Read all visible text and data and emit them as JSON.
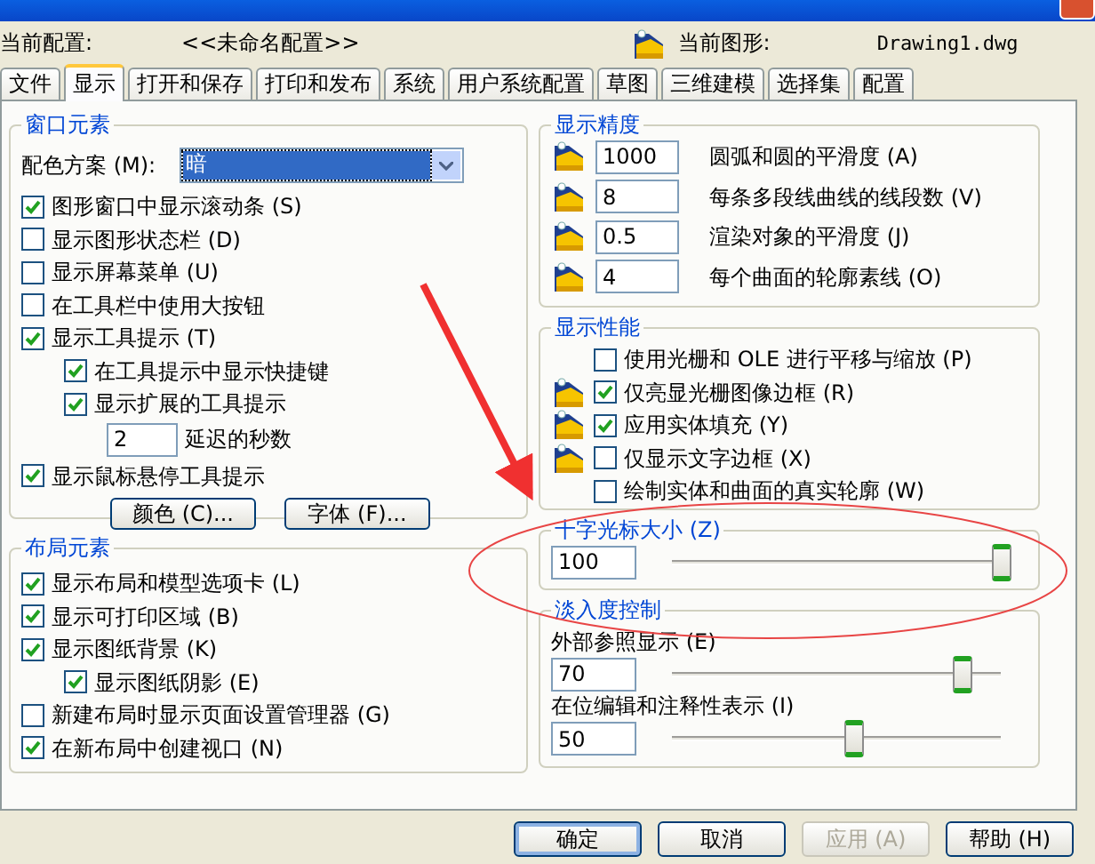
{
  "header": {
    "profile_label": "当前配置:",
    "profile_value": "<<未命名配置>>",
    "drawing_label": "当前图形:",
    "drawing_value": "Drawing1.dwg"
  },
  "tabs": [
    {
      "label": "文件",
      "selected": false
    },
    {
      "label": "显示",
      "selected": true
    },
    {
      "label": "打开和保存",
      "selected": false
    },
    {
      "label": "打印和发布",
      "selected": false
    },
    {
      "label": "系统",
      "selected": false
    },
    {
      "label": "用户系统配置",
      "selected": false
    },
    {
      "label": "草图",
      "selected": false
    },
    {
      "label": "三维建模",
      "selected": false
    },
    {
      "label": "选择集",
      "selected": false
    },
    {
      "label": "配置",
      "selected": false
    }
  ],
  "window_elements": {
    "title": "窗口元素",
    "color_scheme": {
      "label": "配色方案 (M):",
      "value": "暗"
    },
    "items": [
      {
        "kind": "checkbox",
        "label": "图形窗口中显示滚动条 (S)",
        "checked": true
      },
      {
        "kind": "checkbox",
        "label": "显示图形状态栏 (D)",
        "checked": false
      },
      {
        "kind": "checkbox",
        "label": "显示屏幕菜单 (U)",
        "checked": false
      },
      {
        "kind": "checkbox",
        "label": "在工具栏中使用大按钮",
        "checked": false
      },
      {
        "kind": "checkbox",
        "label": "显示工具提示 (T)",
        "checked": true,
        "children": [
          {
            "kind": "checkbox",
            "label": "在工具提示中显示快捷键",
            "checked": true
          },
          {
            "kind": "checkbox",
            "label": "显示扩展的工具提示",
            "checked": true,
            "children": [
              {
                "kind": "number",
                "value": "2",
                "label": "延迟的秒数"
              }
            ]
          }
        ]
      },
      {
        "kind": "checkbox",
        "label": "显示鼠标悬停工具提示",
        "checked": true
      }
    ],
    "buttons": [
      "颜色 (C)...",
      "字体 (F)..."
    ]
  },
  "layout_elements": {
    "title": "布局元素",
    "items": [
      {
        "kind": "checkbox",
        "label": "显示布局和模型选项卡 (L)",
        "checked": true
      },
      {
        "kind": "checkbox",
        "label": "显示可打印区域 (B)",
        "checked": true
      },
      {
        "kind": "checkbox",
        "label": "显示图纸背景 (K)",
        "checked": true,
        "children": [
          {
            "kind": "checkbox",
            "label": "显示图纸阴影 (E)",
            "checked": true
          }
        ]
      },
      {
        "kind": "checkbox",
        "label": "新建布局时显示页面设置管理器 (G)",
        "checked": false
      },
      {
        "kind": "checkbox",
        "label": "在新布局中创建视口 (N)",
        "checked": true
      }
    ]
  },
  "display_resolution": {
    "title": "显示精度",
    "rows": [
      {
        "value": "1000",
        "label": "圆弧和圆的平滑度 (A)"
      },
      {
        "value": "8",
        "label": "每条多段线曲线的线段数 (V)"
      },
      {
        "value": "0.5",
        "label": "渲染对象的平滑度 (J)"
      },
      {
        "value": "4",
        "label": "每个曲面的轮廓素线 (O)"
      }
    ]
  },
  "display_performance": {
    "title": "显示性能",
    "rows": [
      {
        "label": "使用光栅和 OLE 进行平移与缩放 (P)",
        "checked": false,
        "drawing_icon": false
      },
      {
        "label": "仅亮显光栅图像边框 (R)",
        "checked": true,
        "drawing_icon": true
      },
      {
        "label": "应用实体填充 (Y)",
        "checked": true,
        "drawing_icon": true
      },
      {
        "label": "仅显示文字边框 (X)",
        "checked": false,
        "drawing_icon": true
      },
      {
        "label": "绘制实体和曲面的真实轮廓 (W)",
        "checked": false,
        "drawing_icon": false
      }
    ]
  },
  "crosshair_size": {
    "title": "十字光标大小 (Z)",
    "value": "100",
    "level": 1.0
  },
  "fade_control": {
    "title": "淡入度控制",
    "sliders": [
      {
        "label": "外部参照显示 (E)",
        "value": "70",
        "level": 0.88
      },
      {
        "label": "在位编辑和注释性表示 (I)",
        "value": "50",
        "level": 0.55
      }
    ]
  },
  "buttons": [
    {
      "label": "确定",
      "default": true,
      "disabled": false
    },
    {
      "label": "取消",
      "default": false,
      "disabled": false
    },
    {
      "label": "应用 (A)",
      "default": false,
      "disabled": true
    },
    {
      "label": "帮助 (H)",
      "default": false,
      "disabled": false
    }
  ]
}
